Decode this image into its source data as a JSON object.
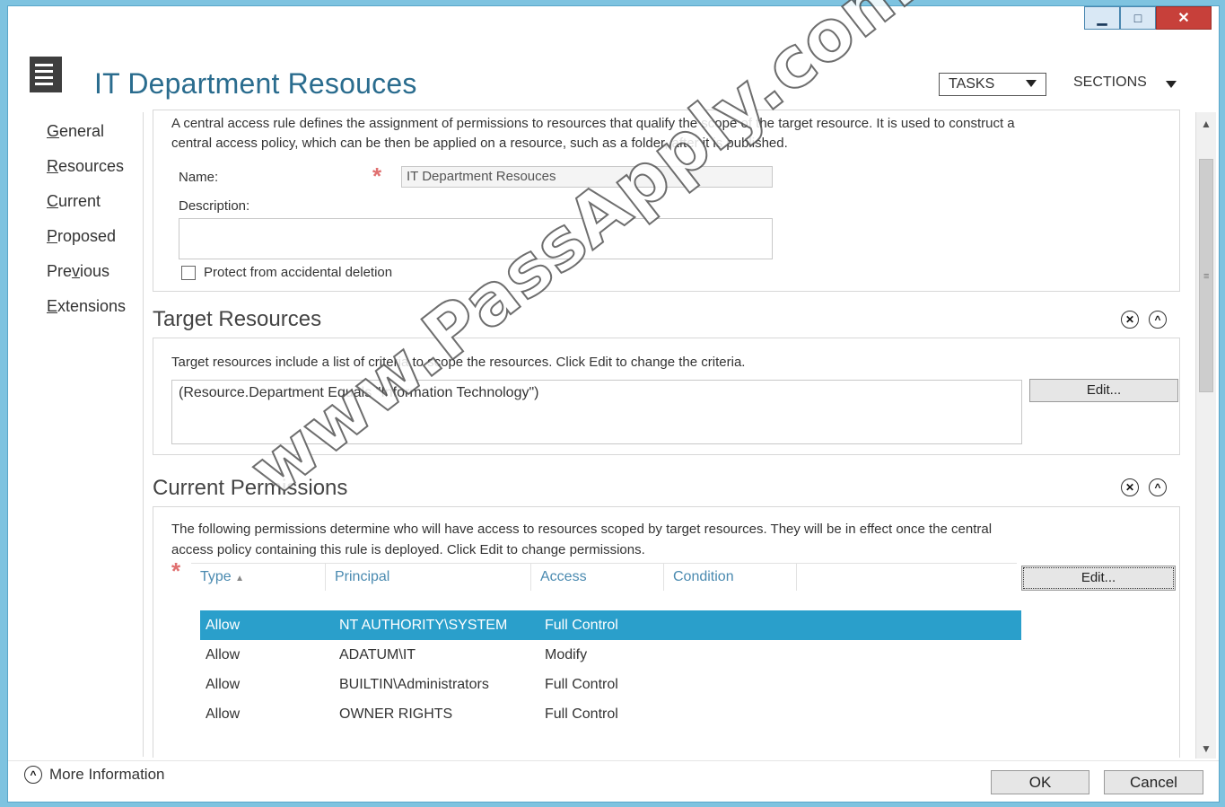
{
  "window": {
    "controls": {
      "minimize": "▁",
      "maximize": "□",
      "close": "✕"
    }
  },
  "header": {
    "icon": "list-icon",
    "title": "IT Department Resouces",
    "tasks_label": "TASKS",
    "sections_label": "SECTIONS"
  },
  "sidebar": {
    "items": [
      {
        "accel": "G",
        "rest": "eneral"
      },
      {
        "accel": "R",
        "rest": "esources"
      },
      {
        "accel": "C",
        "rest": "urrent"
      },
      {
        "accel": "P",
        "rest": "roposed"
      },
      {
        "pre": "Pre",
        "accel": "v",
        "rest": "ious"
      },
      {
        "accel": "E",
        "rest": "xtensions"
      }
    ]
  },
  "general": {
    "intro_line1": "A central access rule defines the assignment of permissions to resources that qualify the scope of the target resource. It is used to construct a",
    "intro_line2": "central access policy, which can be then be applied on a resource, such as a folder, after it is published.",
    "name_label": "Name:",
    "name_value": "IT Department Resouces",
    "description_label": "Description:",
    "protect_label": "Protect from accidental deletion"
  },
  "target_resources": {
    "title": "Target Resources",
    "intro": "Target resources include a list of criteria to scope the resources. Click Edit to change the criteria.",
    "criteria": "(Resource.Department Equals \"Information Technology\")",
    "edit_label": "Edit..."
  },
  "current_permissions": {
    "title": "Current Permissions",
    "intro_line1": "The following permissions determine who will have access to resources scoped by target resources. They will be in effect once the central",
    "intro_line2": "access policy containing this rule is deployed. Click Edit to change permissions.",
    "edit_label": "Edit...",
    "columns": [
      "Type",
      "Principal",
      "Access",
      "Condition"
    ],
    "rows": [
      {
        "type": "Allow",
        "principal": "NT AUTHORITY\\SYSTEM",
        "access": "Full Control"
      },
      {
        "type": "Allow",
        "principal": "ADATUM\\IT",
        "access": "Modify"
      },
      {
        "type": "Allow",
        "principal": "BUILTIN\\Administrators",
        "access": "Full Control"
      },
      {
        "type": "Allow",
        "principal": "OWNER RIGHTS",
        "access": "Full Control"
      }
    ]
  },
  "footer": {
    "more_info_label": "More Information",
    "ok_label": "OK",
    "cancel_label": "Cancel"
  },
  "watermark": "www.PassApply.com",
  "colors": {
    "accent": "#2a6c8e",
    "selection": "#2a9fcb",
    "required": "#e07070"
  }
}
